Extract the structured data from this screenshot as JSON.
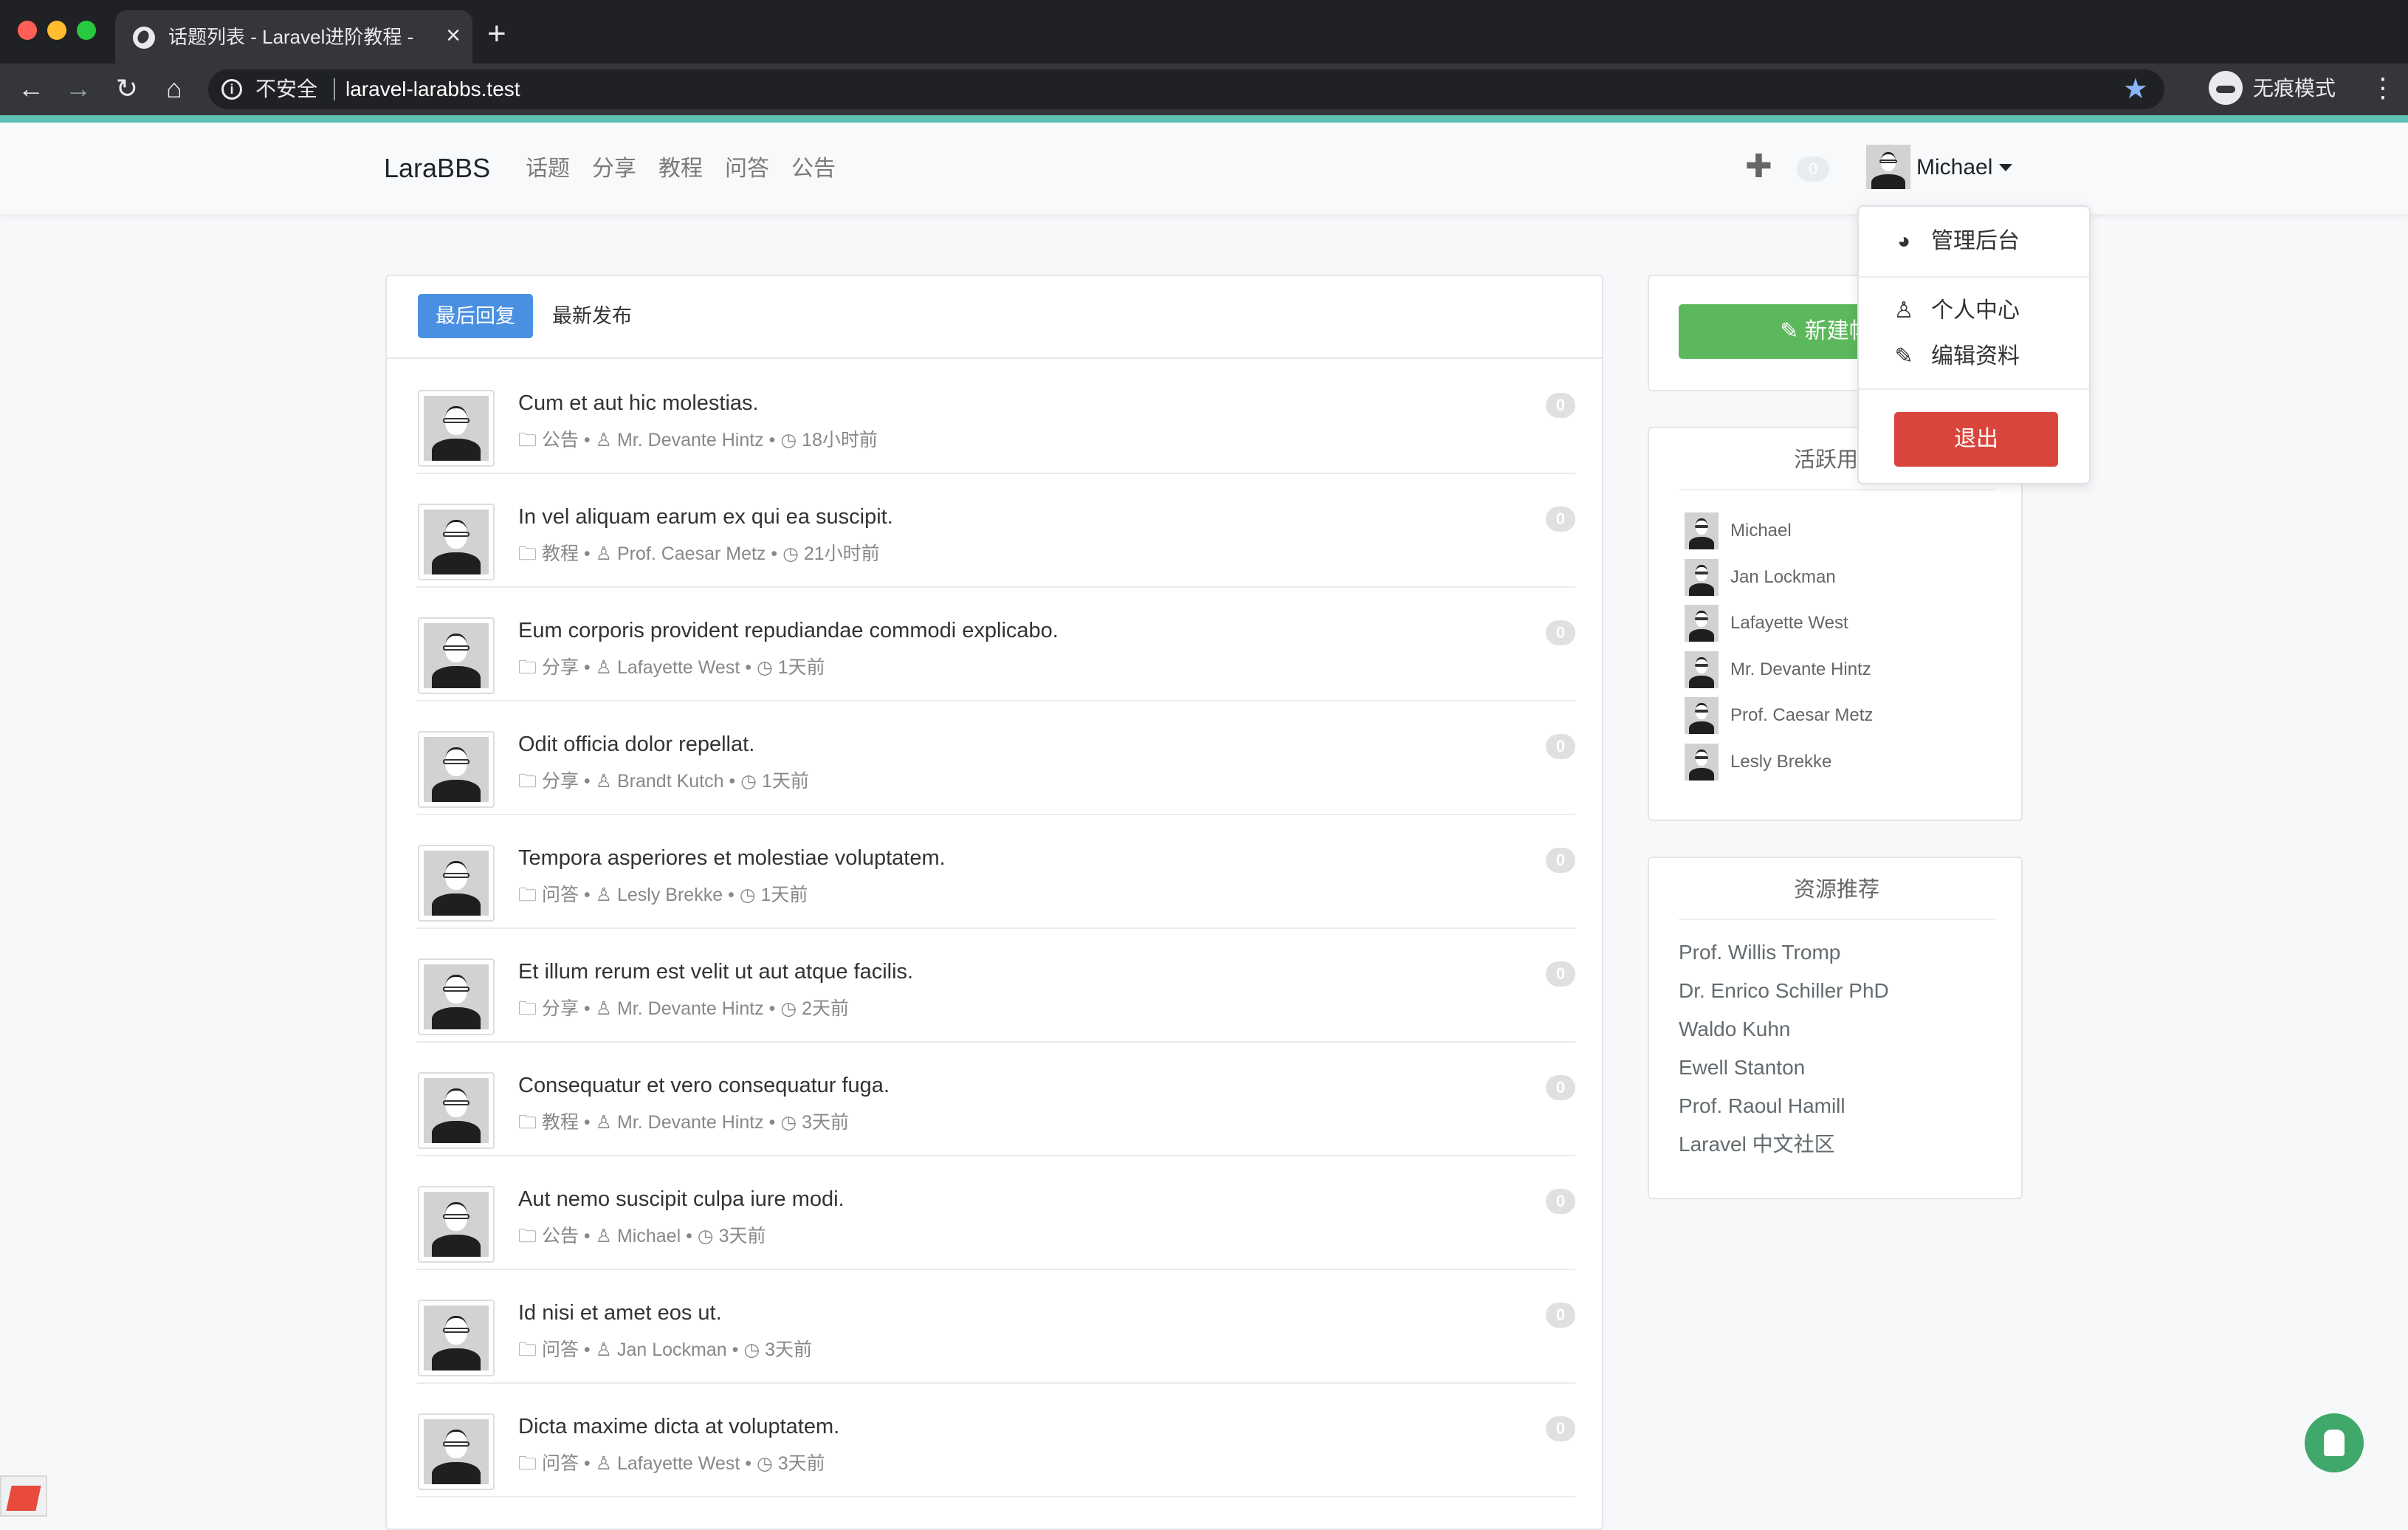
{
  "browser": {
    "tab_title": "话题列表 - Laravel进阶教程 - Po",
    "tab_close": "×",
    "new_tab": "+",
    "security_label": "不安全",
    "url": "laravel-larabbs.test",
    "incognito_label": "无痕模式",
    "icons": [
      "back-icon",
      "forward-icon",
      "reload-icon",
      "home-icon",
      "info-icon",
      "star-icon",
      "incognito-icon",
      "more-icon"
    ]
  },
  "nav": {
    "brand": "LaraBBS",
    "links": [
      {
        "label": "话题"
      },
      {
        "label": "分享"
      },
      {
        "label": "教程"
      },
      {
        "label": "问答"
      },
      {
        "label": "公告"
      }
    ],
    "plus": "✚",
    "notification_count": "0",
    "user_name": "Michael"
  },
  "topic_tabs": {
    "active": "最后回复",
    "other": "最新发布"
  },
  "topics": [
    {
      "title": "Cum et aut hic molestias.",
      "category": "公告",
      "author": "Mr. Devante Hintz",
      "time": "18小时前",
      "replies": "0"
    },
    {
      "title": "In vel aliquam earum ex qui ea suscipit.",
      "category": "教程",
      "author": "Prof. Caesar Metz",
      "time": "21小时前",
      "replies": "0"
    },
    {
      "title": "Eum corporis provident repudiandae commodi explicabo.",
      "category": "分享",
      "author": "Lafayette West",
      "time": "1天前",
      "replies": "0"
    },
    {
      "title": "Odit officia dolor repellat.",
      "category": "分享",
      "author": "Brandt Kutch",
      "time": "1天前",
      "replies": "0"
    },
    {
      "title": "Tempora asperiores et molestiae voluptatem.",
      "category": "问答",
      "author": "Lesly Brekke",
      "time": "1天前",
      "replies": "0"
    },
    {
      "title": "Et illum rerum est velit ut aut atque facilis.",
      "category": "分享",
      "author": "Mr. Devante Hintz",
      "time": "2天前",
      "replies": "0"
    },
    {
      "title": "Consequatur et vero consequatur fuga.",
      "category": "教程",
      "author": "Mr. Devante Hintz",
      "time": "3天前",
      "replies": "0"
    },
    {
      "title": "Aut nemo suscipit culpa iure modi.",
      "category": "公告",
      "author": "Michael",
      "time": "3天前",
      "replies": "0"
    },
    {
      "title": "Id nisi et amet eos ut.",
      "category": "问答",
      "author": "Jan Lockman",
      "time": "3天前",
      "replies": "0"
    },
    {
      "title": "Dicta maxime dicta at voluptatem.",
      "category": "问答",
      "author": "Lafayette West",
      "time": "3天前",
      "replies": "0"
    }
  ],
  "sidebar": {
    "new_topic_label": "新建帖子",
    "active_users_title": "活跃用户",
    "active_users": [
      "Michael",
      "Jan Lockman",
      "Lafayette West",
      "Mr. Devante Hintz",
      "Prof. Caesar Metz",
      "Lesly Brekke"
    ],
    "resources_title": "资源推荐",
    "resources": [
      "Prof. Willis Tromp",
      "Dr. Enrico Schiller PhD",
      "Waldo Kuhn",
      "Ewell Stanton",
      "Prof. Raoul Hamill",
      "Laravel 中文社区"
    ]
  },
  "dropdown": {
    "admin": "管理后台",
    "profile": "个人中心",
    "edit": "编辑资料",
    "logout": "退出"
  },
  "colors": {
    "primary": "#4a90e2",
    "success": "#5cb85c",
    "danger": "#d9453c",
    "accent_line": "#5ec1b4"
  }
}
